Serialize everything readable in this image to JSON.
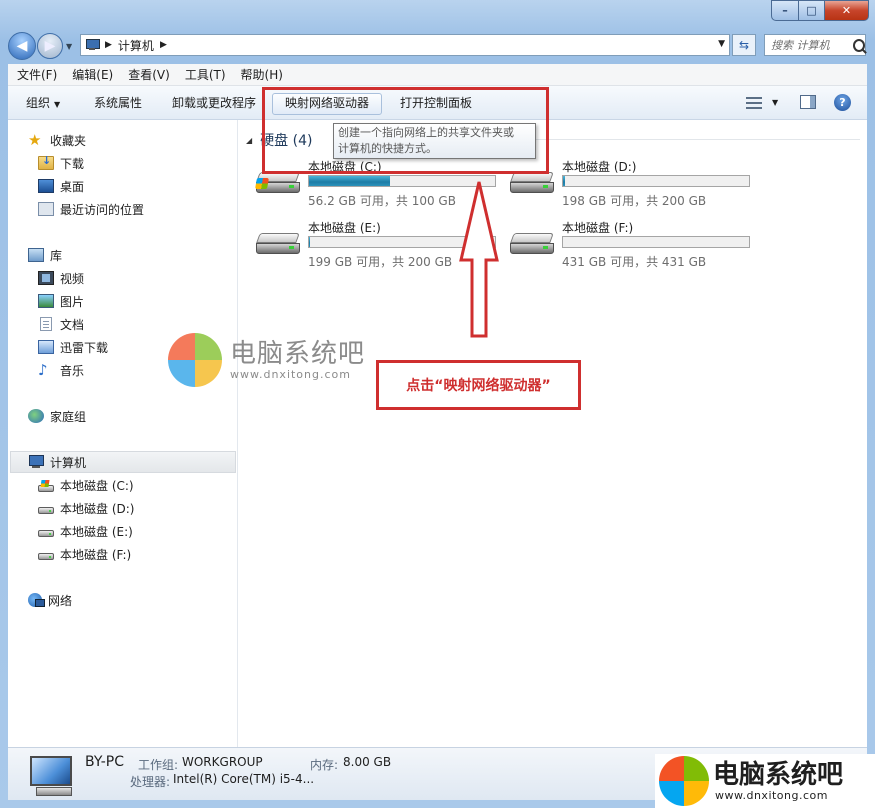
{
  "address": {
    "crumb": "计算机"
  },
  "search": {
    "placeholder": "搜索 计算机"
  },
  "menu": [
    "文件(F)",
    "编辑(E)",
    "查看(V)",
    "工具(T)",
    "帮助(H)"
  ],
  "toolbar": {
    "organize": "组织",
    "system_properties": "系统属性",
    "uninstall": "卸载或更改程序",
    "map_drive": "映射网络驱动器",
    "control_panel": "打开控制面板"
  },
  "nav": {
    "favorites": "收藏夹",
    "downloads": "下载",
    "desktop": "桌面",
    "recent": "最近访问的位置",
    "libraries": "库",
    "videos": "视频",
    "pictures": "图片",
    "documents": "文档",
    "xunlei": "迅雷下载",
    "music": "音乐",
    "homegroup": "家庭组",
    "computer": "计算机",
    "drive_c": "本地磁盘 (C:)",
    "drive_d": "本地磁盘 (D:)",
    "drive_e": "本地磁盘 (E:)",
    "drive_f": "本地磁盘 (F:)",
    "network": "网络"
  },
  "group": {
    "title": "硬盘 (4)"
  },
  "tooltip": {
    "line1": "创建一个指向网络上的共享文件夹或",
    "line2": "计算机的快捷方式。"
  },
  "drives": [
    {
      "name": "本地磁盘 (C:)",
      "info": "56.2 GB 可用，共 100 GB",
      "used_fraction": 0.438
    },
    {
      "name": "本地磁盘 (D:)",
      "info": "198 GB 可用，共 200 GB",
      "used_fraction": 0.01
    },
    {
      "name": "本地磁盘 (E:)",
      "info": "199 GB 可用，共 200 GB",
      "used_fraction": 0.005
    },
    {
      "name": "本地磁盘 (F:)",
      "info": "431 GB 可用，共 431 GB",
      "used_fraction": 0.0
    }
  ],
  "annotation": {
    "text": "点击“映射网络驱动器”"
  },
  "watermark": {
    "title": "电脑系统吧",
    "url": "www.dnxitong.com"
  },
  "details": {
    "name": "BY-PC",
    "workgroup_label": "工作组:",
    "workgroup": "WORKGROUP",
    "memory_label": "内存:",
    "memory": "8.00 GB",
    "cpu_label": "处理器:",
    "cpu": "Intel(R) Core(TM) i5-4..."
  },
  "colors": {
    "annotation": "#cf2f2f",
    "bar_fill": "#1c7ca6"
  }
}
